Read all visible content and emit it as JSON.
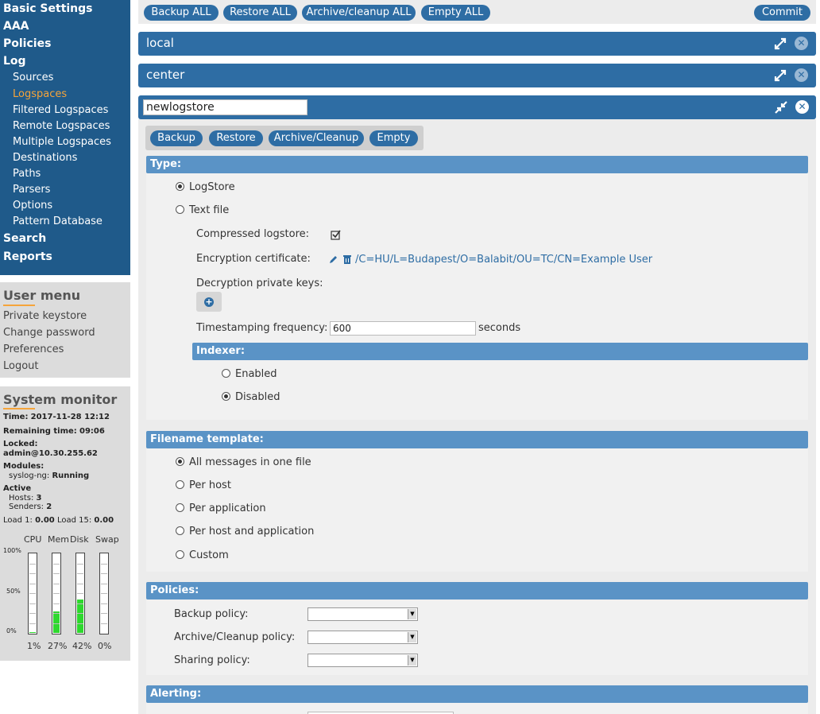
{
  "nav": {
    "top": [
      {
        "label": "Basic Settings"
      },
      {
        "label": "AAA"
      },
      {
        "label": "Policies"
      },
      {
        "label": "Log"
      }
    ],
    "log_items": [
      {
        "label": "Sources",
        "active": false
      },
      {
        "label": "Logspaces",
        "active": true
      },
      {
        "label": "Filtered Logspaces",
        "active": false
      },
      {
        "label": "Remote Logspaces",
        "active": false
      },
      {
        "label": "Multiple Logspaces",
        "active": false
      },
      {
        "label": "Destinations",
        "active": false
      },
      {
        "label": "Paths",
        "active": false
      },
      {
        "label": "Parsers",
        "active": false
      },
      {
        "label": "Options",
        "active": false
      },
      {
        "label": "Pattern Database",
        "active": false
      }
    ],
    "bottom": [
      {
        "label": "Search"
      },
      {
        "label": "Reports"
      }
    ]
  },
  "user_menu": {
    "title": "User menu",
    "items": [
      "Private keystore",
      "Change password",
      "Preferences",
      "Logout"
    ]
  },
  "system_monitor": {
    "title": "System monitor",
    "time_label": "Time:",
    "time": "2017-11-28 12:12",
    "remaining_label": "Remaining time:",
    "remaining": "09:06",
    "locked_label": "Locked:",
    "locked": "admin@10.30.255.62",
    "modules_label": "Modules:",
    "module_name": "syslog-ng:",
    "module_status": "Running",
    "active_label": "Active",
    "hosts_label": "Hosts:",
    "hosts": "3",
    "senders_label": "Senders:",
    "senders": "2",
    "load1_label": "Load 1:",
    "load1": "0.00",
    "load15_label": "Load 15:",
    "load15": "0.00",
    "gauge_headers": [
      "CPU",
      "Mem",
      "Disk",
      "Swap"
    ],
    "scale": [
      "100%",
      "50%",
      "0%"
    ],
    "gauges": [
      {
        "name": "CPU",
        "percent": 1,
        "label": "1%"
      },
      {
        "name": "Mem",
        "percent": 27,
        "label": "27%"
      },
      {
        "name": "Disk",
        "percent": 42,
        "label": "42%"
      },
      {
        "name": "Swap",
        "percent": 0,
        "label": "0%"
      }
    ]
  },
  "toolbar": {
    "backup_all": "Backup ALL",
    "restore_all": "Restore ALL",
    "archive_all": "Archive/cleanup ALL",
    "empty_all": "Empty ALL",
    "commit": "Commit"
  },
  "logspaces": {
    "local": "local",
    "center": "center",
    "current_name": "newlogstore"
  },
  "actions": {
    "backup": "Backup",
    "restore": "Restore",
    "archive": "Archive/Cleanup",
    "empty": "Empty"
  },
  "type_section": {
    "title": "Type:",
    "logstore": "LogStore",
    "textfile": "Text file",
    "selected": "LogStore",
    "compressed_label": "Compressed logstore:",
    "compressed": true,
    "encryption_label": "Encryption certificate:",
    "encryption_value": "/C=HU/L=Budapest/O=Balabit/OU=TC/CN=Example User",
    "decryption_label": "Decryption private keys:",
    "timestamp_label": "Timestamping frequency:",
    "timestamp_value": "600",
    "timestamp_unit": "seconds"
  },
  "indexer": {
    "title": "Indexer:",
    "enabled": "Enabled",
    "disabled": "Disabled",
    "selected": "Disabled"
  },
  "filename_template": {
    "title": "Filename template:",
    "options": [
      "All messages in one file",
      "Per host",
      "Per application",
      "Per host and application",
      "Custom"
    ],
    "selected": "All messages in one file"
  },
  "policies": {
    "title": "Policies:",
    "backup_label": "Backup policy:",
    "archive_label": "Archive/Cleanup policy:",
    "sharing_label": "Sharing policy:"
  },
  "alerting": {
    "title": "Alerting:"
  },
  "colors": {
    "nav_bg": "#1f5a8a",
    "accent": "#f5a43a",
    "button": "#2e6da4",
    "section_bar": "#5a93c6",
    "gauge_fill": "#2ed82e"
  }
}
